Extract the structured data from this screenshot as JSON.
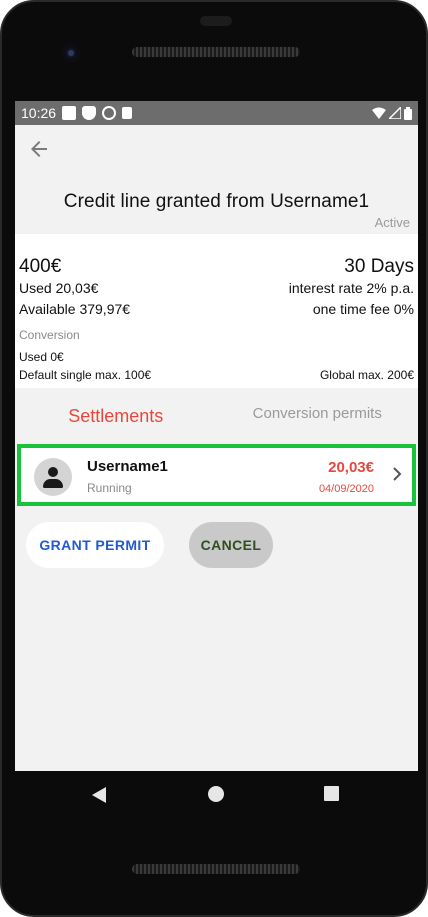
{
  "statusbar": {
    "time": "10:26",
    "icons": [
      "square-icon",
      "shield-icon",
      "circle-icon",
      "card-icon"
    ],
    "right_icons": [
      "wifi-icon",
      "signal-icon",
      "battery-icon"
    ]
  },
  "header": {
    "back_icon": "arrow-back-icon",
    "title": "Credit line granted from Username1",
    "status": "Active"
  },
  "credit": {
    "amount": "400€",
    "duration": "30 Days",
    "used": "Used 20,03€",
    "interest": "interest rate 2% p.a.",
    "available": "Available 379,97€",
    "fee": "one time fee 0%",
    "conversion_label": "Conversion",
    "conversion_used": "Used 0€",
    "default_single_max": "Default single max. 100€",
    "global_max": "Global max. 200€"
  },
  "tabs": {
    "settlements": "Settlements",
    "conversion_permits": "Conversion permits"
  },
  "settlement": {
    "name": "Username1",
    "status": "Running",
    "amount": "20,03€",
    "date": "04/09/2020",
    "chevron": "›"
  },
  "actions": {
    "grant": "GRANT PERMIT",
    "cancel": "CANCEL"
  },
  "colors": {
    "accent_red": "#e8473e",
    "highlight_green": "#19c23b",
    "grant_blue": "#1f5bd6",
    "cancel_text": "#2f4f1e"
  }
}
